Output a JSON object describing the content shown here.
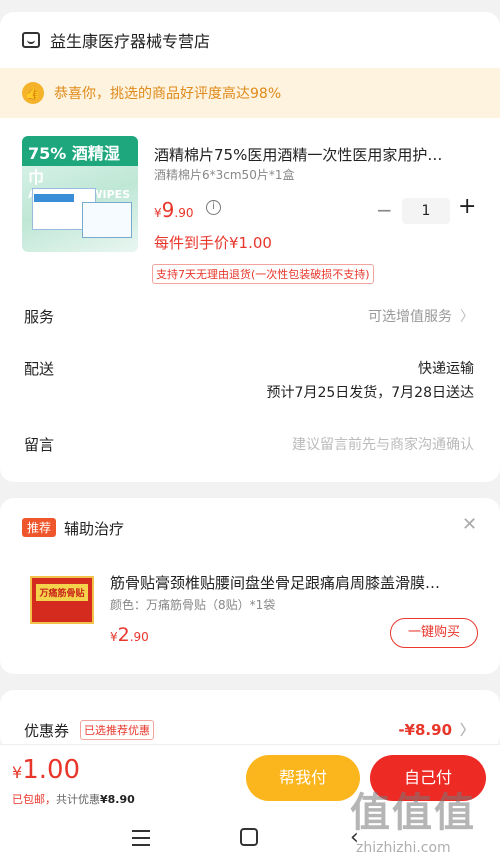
{
  "shop": {
    "name": "益生康医疗器械专营店",
    "icon": "store-icon"
  },
  "praise": {
    "text": "恭喜你，挑选的商品好评度高达98%",
    "icon": "thumbs-up-icon"
  },
  "product": {
    "title": "酒精棉片75%医用酒精一次性医用家用护…",
    "spec": "酒精棉片6*3cm50片*1盒",
    "price_symbol": "¥",
    "price_int": "9",
    "price_dec": ".90",
    "quantity": "1",
    "final_price": "每件到手价¥1.00",
    "policy": "支持7天无理由退货(一次性包装破损不支持)",
    "image_label": "75% 酒精湿巾",
    "image_sub": "ALCOHOL WIPES"
  },
  "rows": {
    "service": {
      "label": "服务",
      "value": "可选增值服务"
    },
    "delivery": {
      "label": "配送",
      "value": "快递运输",
      "detail": "预计7月25日发货，7月28日送达"
    },
    "message": {
      "label": "留言",
      "placeholder": "建议留言前先与商家沟通确认"
    }
  },
  "recommend": {
    "tag": "推荐",
    "title": "辅助治疗",
    "item_name": "筋骨贴膏颈椎贴腰间盘坐骨足跟痛肩周膝盖滑膜…",
    "item_spec": "颜色：万痛筋骨贴（8贴）*1袋",
    "price_symbol": "¥",
    "price_int": "2",
    "price_dec": ".90",
    "buy_label": "一键购买",
    "image_label": "万痛筋骨贴"
  },
  "coupon": {
    "label": "优惠券",
    "tag": "已选推荐优惠",
    "value": "-¥8.90"
  },
  "bottom": {
    "currency": "¥",
    "total": "1.00",
    "shipping": "已包邮，",
    "discount_prefix": "共计优惠",
    "discount_value": "¥8.90",
    "help_pay": "帮我付",
    "self_pay": "自己付"
  },
  "watermark": {
    "text": "值值值",
    "url": "zhizhizhi.com"
  },
  "colors": {
    "accent": "#e8362b",
    "help": "#fbb51d",
    "self": "#ee2a25"
  }
}
